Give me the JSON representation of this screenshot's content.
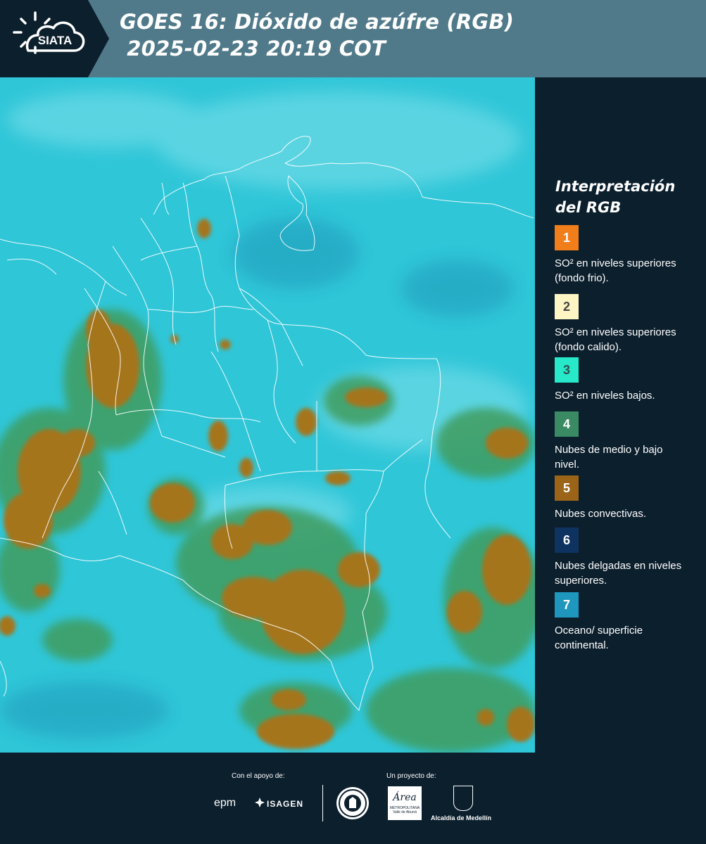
{
  "header": {
    "logo_text": "SIATA",
    "title_line1": "GOES 16: Dióxido de azúfre (RGB)",
    "title_line2": " 2025-02-23 20:19 COT"
  },
  "legend": {
    "title": "Interpretación del RGB",
    "items": [
      {
        "number": "1",
        "label": "SO² en niveles superiores (fondo frio).",
        "color": "#f07e1a",
        "text_color": "#ffffff"
      },
      {
        "number": "2",
        "label": "SO² en niveles superiores (fondo calido).",
        "color": "#fdf5c4",
        "text_color": "#444444"
      },
      {
        "number": "3",
        "label": "SO² en niveles bajos.",
        "color": "#27e8c8",
        "text_color": "#2f4f4f"
      },
      {
        "number": "4",
        "label": "Nubes de medio y bajo nivel.",
        "color": "#3a8a63",
        "text_color": "#ffffff"
      },
      {
        "number": "5",
        "label": "Nubes convectivas.",
        "color": "#9c6418",
        "text_color": "#ffffff"
      },
      {
        "number": "6",
        "label": "Nubes delgadas en niveles superiores.",
        "color": "#0f3360",
        "text_color": "#ffffff"
      },
      {
        "number": "7",
        "label": "Oceano/ superficie continental.",
        "color": "#1e96bd",
        "text_color": "#ffffff"
      }
    ]
  },
  "map": {
    "background_color": "#2fc6d8",
    "convective_color": "#a5741c",
    "midlevel_color": "#3f9c5e",
    "border_color": "#ffffff"
  },
  "footer": {
    "support_caption": "Con el apoyo de:",
    "project_caption": "Un proyecto de:",
    "epm_text": "epm",
    "isagen_text": "ISAGEN",
    "metropolitana_text": "Área",
    "metropolitana_sub": "METROPOLITANA Valle de Aburrá",
    "alcaldia_text": "Alcaldía de Medellín"
  }
}
